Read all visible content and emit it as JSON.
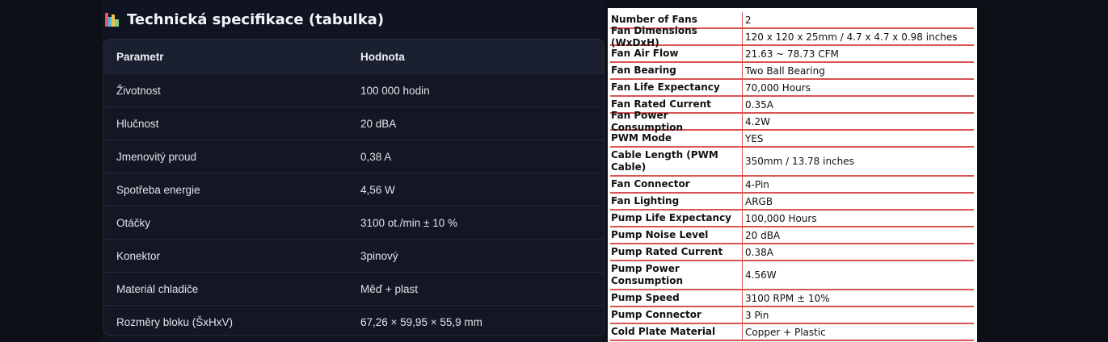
{
  "left": {
    "title": "Technická specifikace (tabulka)",
    "headers": [
      "Parametr",
      "Hodnota"
    ],
    "rows": [
      [
        "Životnost",
        "100 000 hodin"
      ],
      [
        "Hlučnost",
        "20 dBA"
      ],
      [
        "Jmenovitý proud",
        "0,38 A"
      ],
      [
        "Spotřeba energie",
        "4,56 W"
      ],
      [
        "Otáčky",
        "3100 ot./min ± 10 %"
      ],
      [
        "Konektor",
        "3pinový"
      ],
      [
        "Materiál chladiče",
        "Měď + plast"
      ],
      [
        "Rozměry bloku (ŠxHxV)",
        "67,26 × 59,95 × 55,9 mm"
      ]
    ]
  },
  "right": {
    "rows": [
      [
        "Number of Fans",
        "2"
      ],
      [
        "Fan Dimensions (WxDxH)",
        "120 x 120 x 25mm / 4.7 x 4.7 x 0.98 inches"
      ],
      [
        "Fan Air Flow",
        "21.63 ~ 78.73 CFM"
      ],
      [
        "Fan Bearing",
        "Two Ball Bearing"
      ],
      [
        "Fan Life Expectancy",
        "70,000 Hours"
      ],
      [
        "Fan Rated Current",
        "0.35A"
      ],
      [
        "Fan Power Consumption",
        "4.2W"
      ],
      [
        "PWM Mode",
        "YES"
      ],
      [
        "Cable Length (PWM Cable)",
        "350mm / 13.78 inches"
      ],
      [
        "Fan Connector",
        "4-Pin"
      ],
      [
        "Fan Lighting",
        "ARGB"
      ],
      [
        "Pump Life Expectancy",
        "100,000 Hours"
      ],
      [
        "Pump Noise Level",
        "20 dBA"
      ],
      [
        "Pump Rated Current",
        "0.38A"
      ],
      [
        "Pump Power Consumption",
        "4.56W"
      ],
      [
        "Pump Speed",
        "3100 RPM ± 10%"
      ],
      [
        "Pump Connector",
        "3 Pin"
      ],
      [
        "Cold Plate Material",
        "Copper + Plastic"
      ]
    ]
  },
  "colors": {
    "icon_bars": [
      "#e05b5b",
      "#4fb3e8",
      "#f2c14e",
      "#7bd389"
    ],
    "table_rule": "#d9534f"
  },
  "icons": {
    "title_icon": "bar-chart-icon"
  }
}
